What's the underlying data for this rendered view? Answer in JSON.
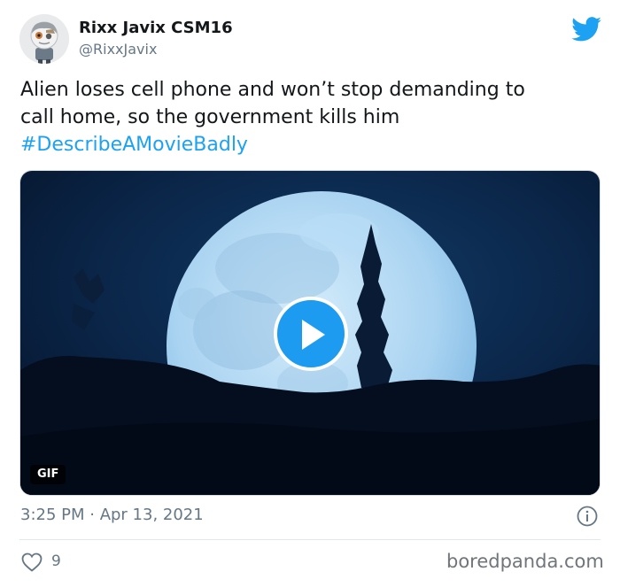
{
  "author": {
    "display_name": "Rixx Javix CSM16",
    "handle": "@RixxJavix",
    "avatar_icon": "cartoon-character-avatar"
  },
  "tweet": {
    "text_line_1": "Alien loses cell phone and won’t stop demanding to",
    "text_line_2": "call home, so the government kills him",
    "hashtag": "#DescribeAMovieBadly"
  },
  "media": {
    "badge": "GIF",
    "play_icon": "play-icon"
  },
  "footer": {
    "timestamp": "3:25 PM · Apr 13, 2021",
    "info_icon": "info-icon",
    "like_icon": "heart-icon",
    "like_count": "9",
    "watermark": "boredpanda.com"
  },
  "colors": {
    "accent": "#1da1f2",
    "text": "#14171a",
    "muted": "#657786"
  }
}
